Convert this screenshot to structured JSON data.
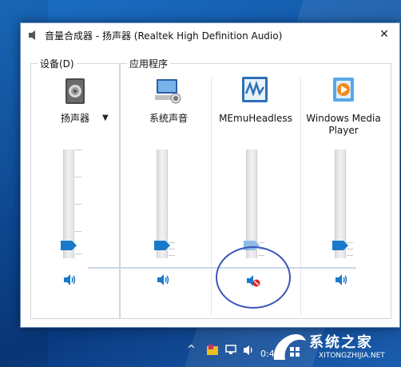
{
  "window": {
    "title": "音量合成器 - 扬声器 (Realtek High Definition Audio)",
    "close_glyph": "✕"
  },
  "device_group": {
    "label": "设备(D)",
    "device_name": "扬声器",
    "dropdown_glyph": "▼",
    "volume_percent": 0
  },
  "apps_group": {
    "label": "应用程序",
    "apps": [
      {
        "name": "系统声音",
        "muted": false,
        "volume_percent": 0
      },
      {
        "name": "MEmuHeadless",
        "muted": true,
        "volume_percent": 0
      },
      {
        "name": "Windows Media Player",
        "muted": false,
        "volume_percent": 0
      }
    ]
  },
  "taskbar": {
    "time_fragment": "0:4",
    "watermark_title": "系统之家",
    "watermark_sub": "XITONGZHIJIA.NET"
  },
  "colors": {
    "accent": "#1979ca",
    "annotation": "#3b56b8",
    "mute_badge": "#e02020"
  }
}
